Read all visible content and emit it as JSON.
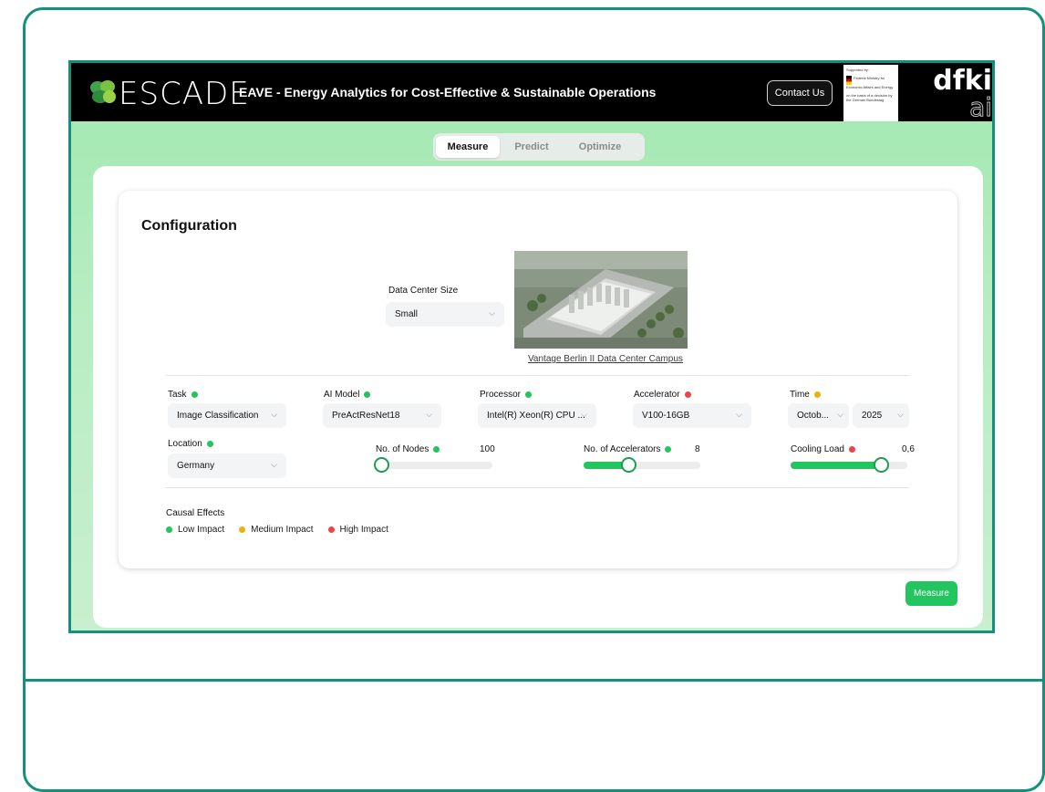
{
  "header": {
    "brand": "ESCADE",
    "subtitle": "EAVE - Energy Analytics for Cost-Effective & Sustainable Operations",
    "contact_label": "Contact Us",
    "sponsor_text": [
      "Supported by:",
      "Federal Ministry for Economic Affairs and Energy",
      "on the basis of a decision by the German Bundestag"
    ],
    "dfki_top": "dfki",
    "dfki_bottom": "ai"
  },
  "tabs": [
    {
      "label": "Measure",
      "active": true
    },
    {
      "label": "Predict",
      "active": false
    },
    {
      "label": "Optimize",
      "active": false
    }
  ],
  "config": {
    "title": "Configuration",
    "data_center_size": {
      "label": "Data Center Size",
      "value": "Small"
    },
    "image_caption": "Vantage Berlin II Data Center Campus",
    "task": {
      "label": "Task",
      "value": "Image Classification",
      "impact": "low"
    },
    "ai_model": {
      "label": "AI Model",
      "value": "PreActResNet18",
      "impact": "low"
    },
    "processor": {
      "label": "Processor",
      "value": "Intel(R) Xeon(R) CPU ...",
      "impact": "low"
    },
    "accelerator": {
      "label": "Accelerator",
      "value": "V100-16GB",
      "impact": "high"
    },
    "time": {
      "label": "Time",
      "month": "Octob...",
      "year": "2025",
      "impact": "medium"
    },
    "location": {
      "label": "Location",
      "value": "Germany",
      "impact": "low"
    },
    "nodes": {
      "label": "No. of Nodes",
      "value": "100",
      "impact": "low",
      "level": 0.05
    },
    "accelerators": {
      "label": "No. of Accelerators",
      "value": "8",
      "impact": "low",
      "level": 0.38
    },
    "cooling": {
      "label": "Cooling Load",
      "value": "0,6",
      "impact": "high",
      "level": 0.77
    }
  },
  "legend": {
    "title": "Causal Effects",
    "items": [
      {
        "label": "Low Impact",
        "color": "#22c55e"
      },
      {
        "label": "Medium Impact",
        "color": "#eab308"
      },
      {
        "label": "High Impact",
        "color": "#ef4444"
      }
    ]
  },
  "colors": {
    "low": "#22c55e",
    "medium": "#eab308",
    "high": "#ef4444",
    "frame": "#14917b"
  },
  "measure_button": "Measure"
}
